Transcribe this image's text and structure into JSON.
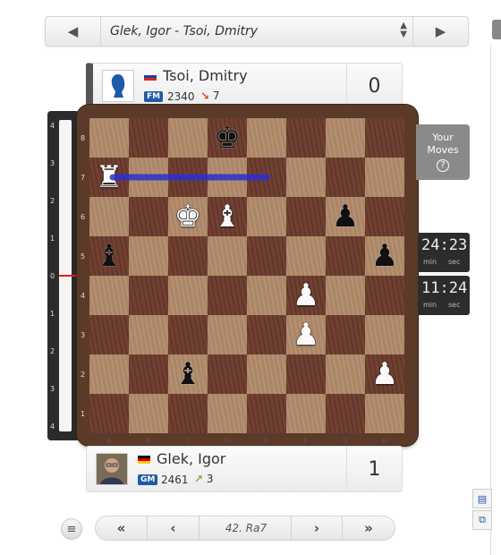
{
  "game": {
    "title": "Glek, Igor - Tsoi, Dmitry"
  },
  "players": {
    "top": {
      "name": "Tsoi, Dmitry",
      "title": "FM",
      "rating": "2340",
      "change": "7",
      "score": "0",
      "change_dir": "down",
      "change_color": "#d9442a",
      "flag": "ru"
    },
    "bottom": {
      "name": "Glek, Igor",
      "title": "GM",
      "rating": "2461",
      "change": "3",
      "score": "1",
      "change_dir": "up",
      "change_color": "#7cb342",
      "flag": "de"
    }
  },
  "eval": {
    "ticks_top": [
      "4",
      "3",
      "2",
      "1",
      "0"
    ],
    "ticks_bottom": [
      "1",
      "2",
      "3",
      "4"
    ]
  },
  "board": {
    "ranks": [
      "8",
      "7",
      "6",
      "5",
      "4",
      "3",
      "2",
      "1"
    ],
    "files": [
      "A",
      "B",
      "C",
      "D",
      "E",
      "F",
      "G",
      "H"
    ],
    "pieces": [
      {
        "sq": "d8",
        "glyph": "♚",
        "color": "b",
        "name": "black-king"
      },
      {
        "sq": "a7",
        "glyph": "♜",
        "color": "w",
        "name": "white-rook"
      },
      {
        "sq": "c6",
        "glyph": "♚",
        "color": "w",
        "name": "white-king"
      },
      {
        "sq": "d6",
        "glyph": "♝",
        "color": "w",
        "name": "white-bishop"
      },
      {
        "sq": "g6",
        "glyph": "♟",
        "color": "b",
        "name": "black-pawn"
      },
      {
        "sq": "a5",
        "glyph": "♝",
        "color": "b",
        "name": "black-bishop"
      },
      {
        "sq": "h5",
        "glyph": "♟",
        "color": "b",
        "name": "black-pawn"
      },
      {
        "sq": "f4",
        "glyph": "♟",
        "color": "w",
        "name": "white-pawn"
      },
      {
        "sq": "f3",
        "glyph": "♟",
        "color": "w",
        "name": "white-pawn"
      },
      {
        "sq": "c2",
        "glyph": "♝",
        "color": "b",
        "name": "black-bishop"
      },
      {
        "sq": "h2",
        "glyph": "♟",
        "color": "w",
        "name": "white-pawn"
      }
    ],
    "last_move_arrow": {
      "from": "e7",
      "to": "a7",
      "color": "#2a2fd0"
    }
  },
  "your_moves": {
    "line1": "Your",
    "line2": "Moves",
    "icon": "?"
  },
  "clocks": [
    {
      "time": "24:23",
      "min": "min",
      "sec": "sec"
    },
    {
      "time": "11:24",
      "min": "min",
      "sec": "sec"
    }
  ],
  "nav": {
    "current_move": "42. Ra7"
  },
  "icons": {
    "prev": "◀",
    "next": "▶",
    "up": "▲",
    "down": "▼",
    "first": "«",
    "back": "‹",
    "forward": "›",
    "last": "»",
    "menu": "≡"
  }
}
